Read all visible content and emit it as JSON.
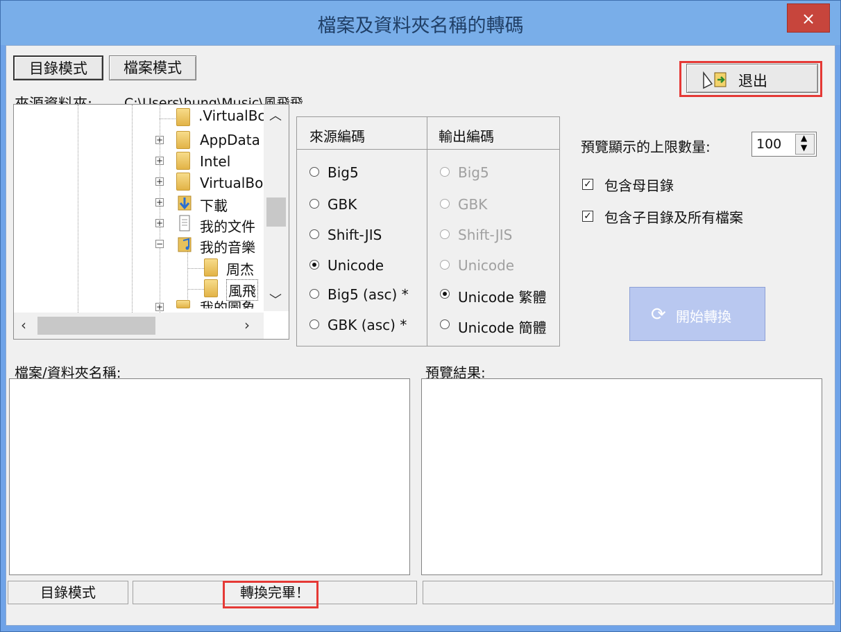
{
  "window": {
    "title": "檔案及資料夾名稱的轉碼",
    "close_glyph": "×"
  },
  "mode_tabs": {
    "directory": "目錄模式",
    "file": "檔案模式"
  },
  "exit_button": "退出",
  "source_folder": {
    "label": "來源資料夾:",
    "path": "C:\\Users\\hung\\Music\\風飛飛"
  },
  "tree": {
    "nodes": [
      ".VirtualBc",
      "AppData",
      "Intel",
      "VirtualBo:",
      "下載",
      "我的文件",
      "我的音樂",
      "周杰",
      "風飛",
      "我的圖象"
    ]
  },
  "encoding": {
    "source_header": "來源編碼",
    "output_header": "輸出編碼",
    "source_options": [
      "Big5",
      "GBK",
      "Shift-JIS",
      "Unicode",
      "Big5 (asc) *",
      "GBK (asc) *"
    ],
    "source_selected": "Unicode",
    "output_options": [
      "Big5",
      "GBK",
      "Shift-JIS",
      "Unicode",
      "Unicode 繁體",
      "Unicode 簡體"
    ],
    "output_selected": "Unicode 繁體"
  },
  "preview_limit": {
    "label": "預覽顯示的上限數量:",
    "value": "100"
  },
  "options": {
    "include_parent": "包含母目錄",
    "include_sub": "包含子目錄及所有檔案",
    "include_parent_checked": true,
    "include_sub_checked": true
  },
  "start_button": "開始轉換",
  "panes": {
    "names_label": "檔案/資料夾名稱:",
    "preview_label": "預覽結果:"
  },
  "statusbar": {
    "mode": "目錄模式",
    "message": "轉換完畢！"
  },
  "colors": {
    "highlight": "#e53935",
    "title_bg": "#79aee9",
    "start_bg": "#b9c8f0"
  }
}
